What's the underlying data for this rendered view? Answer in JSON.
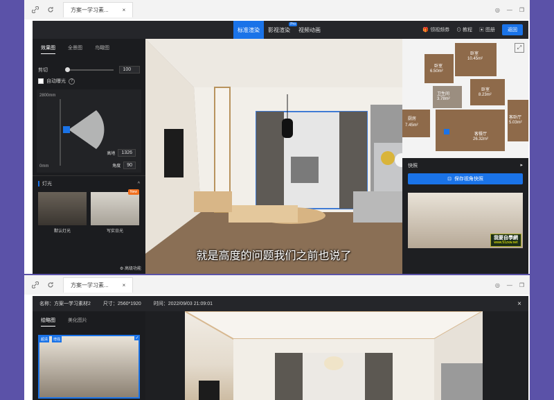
{
  "top_window": {
    "tab_title": "方案一学习素...",
    "app": {
      "modes": [
        {
          "label": "标准渲染",
          "active": true
        },
        {
          "label": "影视渲染",
          "badge": "Pro",
          "active": false
        },
        {
          "label": "视频动画",
          "active": false
        }
      ],
      "tools": {
        "receive_vip": "领视频券",
        "tutorial": "教程",
        "gallery": "图册",
        "new_button": "返回"
      },
      "left_panel": {
        "tabs": [
          "效果图",
          "全景图",
          "鸟瞰图"
        ],
        "clip_label": "剪切",
        "clip_value": "100",
        "auto_exposure": "自动曝光",
        "height_top": "2800mm",
        "height_bottom": "0mm",
        "height_label": "高地",
        "height_value": "1326",
        "angle_label": "角度",
        "angle_value": "90",
        "lighting_title": "灯光",
        "presets": [
          {
            "label": "默认灯光"
          },
          {
            "label": "写实日光",
            "badge": "New"
          }
        ],
        "advanced": "高级功能"
      },
      "minimap": {
        "rooms": [
          {
            "name": "卧室",
            "area": "10.45m²"
          },
          {
            "name": "卧室",
            "area": "6.50m²"
          },
          {
            "name": "卧室",
            "area": "8.23m²"
          },
          {
            "name": "卫生间",
            "area": "3.78m²"
          },
          {
            "name": "厨房",
            "area": "7.45m²"
          },
          {
            "name": "客餐厅",
            "area": "26.32m²"
          },
          {
            "name": "客卧厅",
            "area": "5.03m²"
          }
        ]
      },
      "snapshot": {
        "title": "快照",
        "save_button": "保存视角快照"
      },
      "subtitle": "就是高度的问题我们之前也说了",
      "watermark": {
        "line1": "我要自學網",
        "line2": "www.51zxw.net"
      }
    }
  },
  "bottom_window": {
    "tab_title": "方案一学习素...",
    "info": {
      "name": "名称：方案一学习素材2",
      "size": "尺寸：2560*1920",
      "time": "时间：2022/09/03 21:09:01"
    },
    "tabs": [
      "绘略图",
      "美化图片"
    ],
    "thumb_badges": [
      "超清",
      "增强"
    ]
  }
}
